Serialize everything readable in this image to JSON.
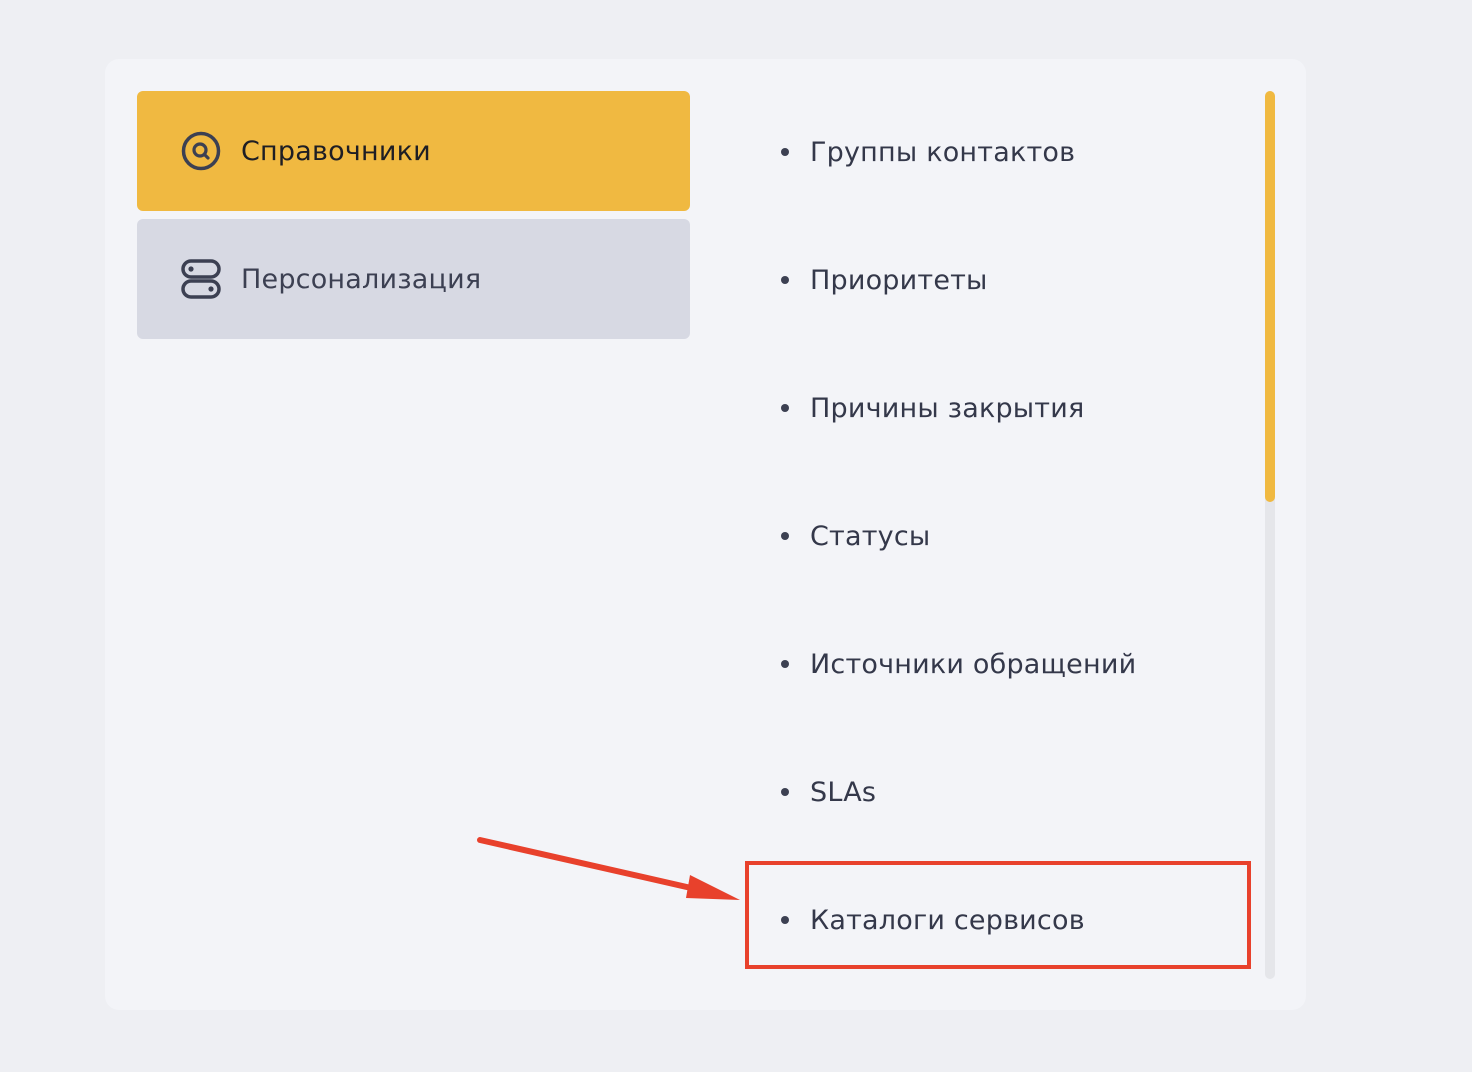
{
  "sidebar": {
    "items": [
      {
        "label": "Справочники",
        "icon": "search-circle-icon",
        "active": true
      },
      {
        "label": "Персонализация",
        "icon": "toggle-switches-icon",
        "active": false
      }
    ]
  },
  "list": {
    "items": [
      {
        "label": "Группы контактов"
      },
      {
        "label": "Приоритеты"
      },
      {
        "label": "Причины закрытия"
      },
      {
        "label": "Статусы"
      },
      {
        "label": "Источники обращений"
      },
      {
        "label": "SLAs"
      },
      {
        "label": "Каталоги сервисов"
      }
    ]
  },
  "colors": {
    "accent": "#f0b941",
    "annotation": "#e8412c",
    "idle_tab": "#d7d9e3",
    "text": "#34384a"
  },
  "annotation": {
    "highlighted_item": "Каталоги сервисов"
  }
}
